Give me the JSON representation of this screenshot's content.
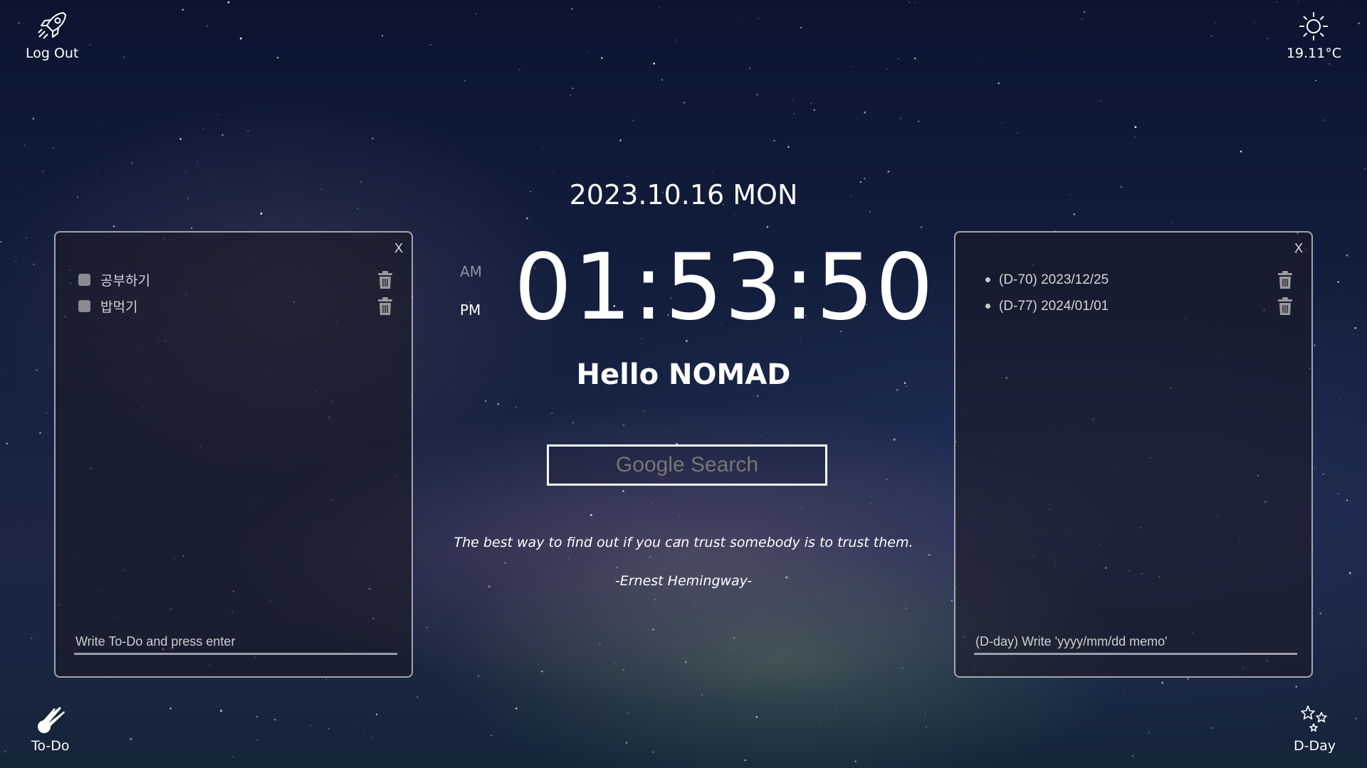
{
  "header": {
    "logout_label": "Log Out",
    "temperature": "19.11°C"
  },
  "footer": {
    "todo_label": "To-Do",
    "dday_label": "D-Day"
  },
  "clock": {
    "date": "2023.10.16 MON",
    "am": "AM",
    "pm": "PM",
    "active_meridiem": "PM",
    "time": "01:53:50"
  },
  "greeting": "Hello NOMAD",
  "search": {
    "placeholder": "Google Search"
  },
  "quote": {
    "text": "The best way to find out if you can trust somebody is to trust them.",
    "author": "-Ernest Hemingway-"
  },
  "todo_panel": {
    "close": "X",
    "items": [
      {
        "text": "공부하기",
        "checked": false
      },
      {
        "text": "밥먹기",
        "checked": false
      }
    ],
    "input_placeholder": "Write To-Do and press enter"
  },
  "dday_panel": {
    "close": "X",
    "items": [
      {
        "text": "(D-70) 2023/12/25"
      },
      {
        "text": "(D-77) 2024/01/01"
      }
    ],
    "input_placeholder": "(D-day) Write 'yyyy/mm/dd memo'"
  },
  "colors": {
    "text": "#ffffff",
    "inactive_meridiem": "#8b93a8",
    "panel_border": "#d2d2dc"
  },
  "icons": {
    "logout": "rocket-icon",
    "weather": "sun-icon",
    "todo": "comet-icon",
    "dday": "stars-icon",
    "delete": "trash-icon"
  }
}
